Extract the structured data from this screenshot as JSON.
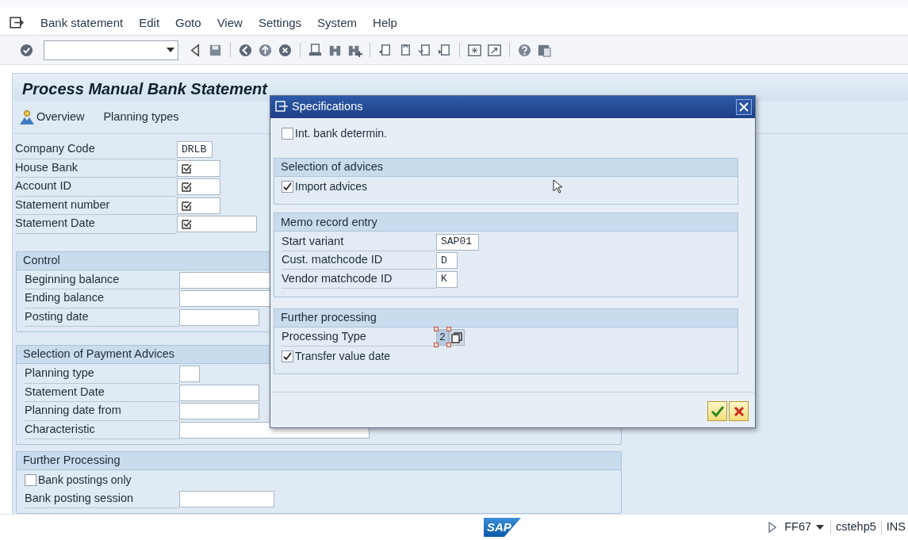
{
  "menu_bar": {
    "items": [
      "Bank statement",
      "Edit",
      "Goto",
      "View",
      "Settings",
      "System",
      "Help"
    ]
  },
  "page": {
    "title": "Process Manual Bank Statement",
    "app_toolbar": [
      {
        "label": "Overview",
        "kind": "icon"
      },
      {
        "label": "Planning types",
        "kind": "text"
      }
    ],
    "header_fields": [
      {
        "label": "Company Code",
        "kind": "value",
        "value": "DRLB"
      },
      {
        "label": "House Bank",
        "kind": "required"
      },
      {
        "label": "Account ID",
        "kind": "required"
      },
      {
        "label": "Statement number",
        "kind": "required"
      },
      {
        "label": "Statement Date",
        "kind": "required"
      }
    ],
    "sections": [
      {
        "title": "Control",
        "rows": [
          {
            "kind": "field",
            "label": "Beginning balance"
          },
          {
            "kind": "field",
            "label": "Ending balance"
          },
          {
            "kind": "field",
            "label": "Posting date"
          }
        ]
      },
      {
        "title": "Selection of Payment Advices",
        "rows": [
          {
            "kind": "field",
            "label": "Planning type"
          },
          {
            "kind": "field",
            "label": "Statement Date"
          },
          {
            "kind": "field",
            "label": "Planning date from"
          },
          {
            "kind": "field",
            "label": "Characteristic"
          }
        ]
      },
      {
        "title": "Further Processing",
        "rows": [
          {
            "kind": "checkbox",
            "label": "Bank postings only",
            "checked": false
          },
          {
            "kind": "field",
            "label": "Bank posting session"
          }
        ]
      }
    ]
  },
  "dialog": {
    "title": "Specifications",
    "top_checkbox": {
      "label": "Int. bank determin.",
      "checked": false
    },
    "groups": [
      {
        "title": "Selection of advices",
        "rows": [
          {
            "kind": "checkbox",
            "label": "Import advices",
            "checked": true
          }
        ]
      },
      {
        "title": "Memo record entry",
        "rows": [
          {
            "kind": "field",
            "label": "Start variant",
            "value": "SAP01"
          },
          {
            "kind": "field",
            "label": "Cust. matchcode ID",
            "value": "D"
          },
          {
            "kind": "field",
            "label": "Vendor matchcode ID",
            "value": "K"
          }
        ]
      },
      {
        "title": "Further processing",
        "rows": [
          {
            "kind": "focused_field",
            "label": "Processing Type",
            "value": "2"
          },
          {
            "kind": "checkbox",
            "label": "Transfer value date",
            "checked": true
          }
        ]
      }
    ]
  },
  "status_bar": {
    "logo_text": "SAP",
    "transaction": "FF67",
    "server": "cstehp5",
    "mode": "INS"
  }
}
